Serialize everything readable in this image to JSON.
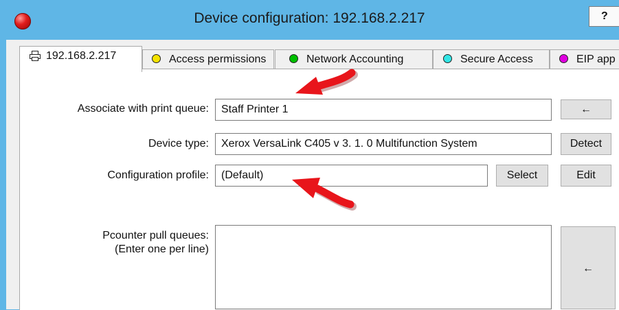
{
  "window": {
    "title": "Device configuration: 192.168.2.217",
    "help_label": "?"
  },
  "tabs": [
    {
      "label": "192.168.2.217",
      "icon": "printer-icon",
      "active": true
    },
    {
      "label": "Access permissions",
      "dot_color": "#f5e300"
    },
    {
      "label": "Network Accounting",
      "dot_color": "#00c000"
    },
    {
      "label": "Secure Access",
      "dot_color": "#33e6e6"
    },
    {
      "label": "EIP app",
      "dot_color": "#e000e0"
    }
  ],
  "form": {
    "print_queue": {
      "label": "Associate with print queue:",
      "value": "Staff Printer 1",
      "button": "←"
    },
    "device_type": {
      "label": "Device type:",
      "value": "Xerox VersaLink C405 v  3.  1.  0 Multifunction System",
      "button": "Detect"
    },
    "config_profile": {
      "label": "Configuration profile:",
      "value": "(Default)",
      "select_button": "Select",
      "edit_button": "Edit"
    },
    "pull_queues": {
      "label_line1": "Pcounter pull queues:",
      "label_line2": "(Enter one per line)",
      "value": "",
      "button": "←"
    }
  },
  "annotation_color": "#e8151b"
}
